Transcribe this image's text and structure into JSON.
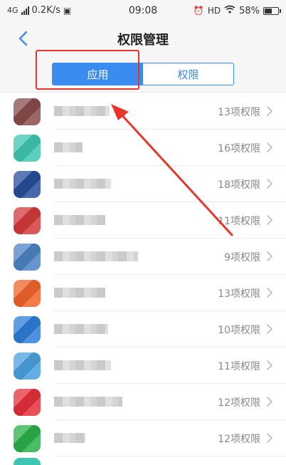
{
  "status": {
    "network": "4G",
    "speed": "0.2K/s",
    "time": "09:08",
    "hd": "HD",
    "battery": "58%",
    "battery_level": 0.58
  },
  "header": {
    "title": "权限管理"
  },
  "tabs": [
    {
      "label": "应用",
      "active": true
    },
    {
      "label": "权限",
      "active": false
    }
  ],
  "apps": [
    {
      "name": "···软件",
      "permissions": "13项权限",
      "icon_color": "#8a4c4c"
    },
    {
      "name": "··快",
      "permissions": "16项权限",
      "icon_color": "#3ec7b0"
    },
    {
      "name": "交通银行",
      "permissions": "18项权限",
      "icon_color": "#274e9c"
    },
    {
      "name": "··助",
      "permissions": "11项权限",
      "icon_color": "#d23a3a"
    },
    {
      "name": "·······",
      "permissions": "9项权限",
      "icon_color": "#4d83c4"
    },
    {
      "name": "····",
      "permissions": "13项权限",
      "icon_color": "#f1642a"
    },
    {
      "name": "····",
      "permissions": "10项权限",
      "icon_color": "#2e7ed9"
    },
    {
      "name": "交通银行",
      "permissions": "11项权限",
      "icon_color": "#4aa0e0"
    },
    {
      "name": "······",
      "permissions": "12项权限",
      "icon_color": "#e6303a"
    },
    {
      "name": "··",
      "permissions": "12项权限",
      "icon_color": "#2bb04a"
    }
  ],
  "colors": {
    "accent": "#3b8cf0",
    "annotation": "#e8352c"
  },
  "icons": {
    "back": "chevron-left-icon",
    "row_chevron": "chevron-right-icon",
    "alarm": "alarm-icon",
    "wifi": "wifi-icon"
  }
}
